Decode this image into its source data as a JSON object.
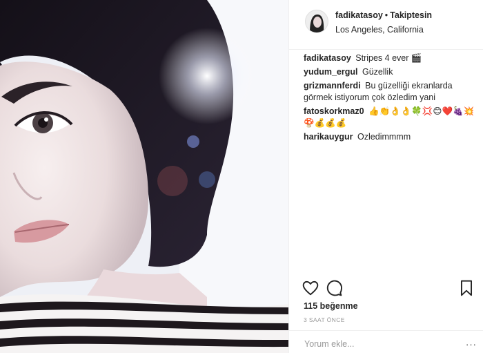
{
  "post": {
    "username": "fadikatasoy",
    "follow_label": "Takiptesin",
    "location": "Los Angeles, California",
    "caption": "Stripes 4 ever 🎬"
  },
  "comments": [
    {
      "user": "fadikatasoy",
      "text": "Stripes 4 ever 🎬"
    },
    {
      "user": "yudum_ergul",
      "text": "Güzellik"
    },
    {
      "user": "grizmannferdi",
      "text": "Bu güzelliği ekranlarda görmek istiyorum çok özledim yani"
    },
    {
      "user": "fatoskorkmaz0",
      "text": "👍👏👌👌🍀💢😊❤️🍇💥 🍄💰💰💰"
    },
    {
      "user": "harikauygur",
      "text": "Ozledimmmm"
    }
  ],
  "actions": {
    "like_icon": "heart-icon",
    "comment_icon": "comment-bubble-icon",
    "save_icon": "bookmark-icon"
  },
  "likes_label": "115 beğenme",
  "time_label": "3 SAAT ÖNCE",
  "add_comment_placeholder": "Yorum ekle...",
  "more_icon": "ellipsis-icon"
}
